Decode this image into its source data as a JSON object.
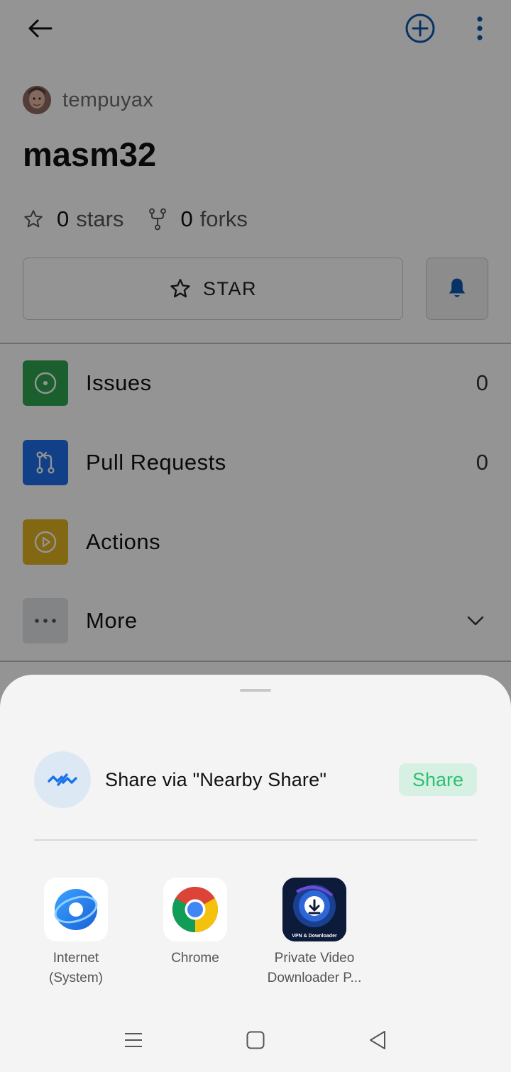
{
  "repo": {
    "owner": "tempuyax",
    "name": "masm32",
    "stars_count": "0",
    "stars_label": "stars",
    "forks_count": "0",
    "forks_label": "forks",
    "star_button_label": "STAR"
  },
  "menu": [
    {
      "label": "Issues",
      "count": "0",
      "icon": "issues-icon",
      "color": "#2da44e"
    },
    {
      "label": "Pull Requests",
      "count": "0",
      "icon": "pull-request-icon",
      "color": "#1f6feb"
    },
    {
      "label": "Actions",
      "count": "",
      "icon": "play-icon",
      "color": "#e0b422"
    },
    {
      "label": "More",
      "count": "",
      "icon": "ellipsis-icon",
      "color": "#e1e3e6"
    }
  ],
  "share_sheet": {
    "nearby_text": "Share via \"Nearby Share\"",
    "share_button": "Share",
    "apps": [
      {
        "line1": "Internet",
        "line2": "(System)",
        "icon": "samsung-internet-icon"
      },
      {
        "line1": "Chrome",
        "line2": "",
        "icon": "chrome-icon"
      },
      {
        "line1": "Private Video",
        "line2": "Downloader P...",
        "icon": "video-downloader-icon",
        "icon_text": "VPN & Downloader"
      }
    ]
  },
  "colors": {
    "accent_blue": "#0b57b0",
    "share_green": "#2fbf71",
    "share_green_bg": "#d6f1e3"
  }
}
